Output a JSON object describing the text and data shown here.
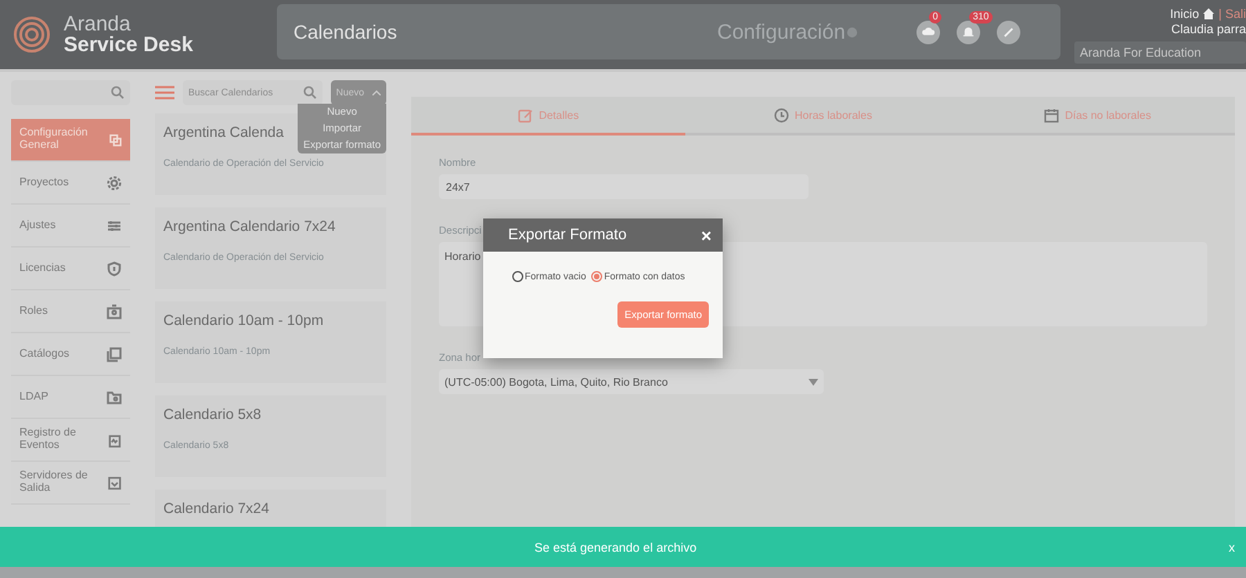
{
  "header": {
    "brand_top": "Aranda",
    "brand_bottom": "Service Desk",
    "page_title": "Calendarios",
    "section": "Configuración",
    "indicators": [
      {
        "kind": "cloud",
        "badge": "0"
      },
      {
        "kind": "bell",
        "badge": "310"
      },
      {
        "kind": "wand"
      }
    ],
    "home_link": "Inicio",
    "logout_link": "| Sali",
    "user": "Claudia parra",
    "tenant": "Aranda For Education"
  },
  "sidebar": {
    "items": [
      {
        "label": "Configuración General",
        "selected": true
      },
      {
        "label": "Proyectos",
        "selected": false
      },
      {
        "label": "Ajustes",
        "selected": false
      },
      {
        "label": "Licencias",
        "selected": false
      },
      {
        "label": "Roles",
        "selected": false
      },
      {
        "label": "Catálogos",
        "selected": false
      },
      {
        "label": "LDAP",
        "selected": false
      },
      {
        "label": "Registro de Eventos",
        "selected": false
      },
      {
        "label": "Servidores de Salida",
        "selected": false
      }
    ]
  },
  "list": {
    "search_placeholder": "Buscar Calendarios",
    "new_button": "Nuevo",
    "menu": [
      "Nuevo",
      "Importar",
      "Exportar formato"
    ],
    "cards": [
      {
        "title": "Argentina Calenda",
        "subtitle": "Calendario de Operación del Servicio"
      },
      {
        "title": "Argentina Calendario 7x24",
        "subtitle": "Calendario de Operación del Servicio"
      },
      {
        "title": "Calendario 10am - 10pm",
        "subtitle": "Calendario 10am - 10pm"
      },
      {
        "title": "Calendario 5x8",
        "subtitle": "Calendario 5x8"
      },
      {
        "title": "Calendario 7x24"
      }
    ]
  },
  "detail": {
    "tabs": [
      {
        "label": "Detalles",
        "selected": true
      },
      {
        "label": "Horas laborales",
        "selected": false
      },
      {
        "label": "Días no laborales",
        "selected": false
      }
    ],
    "name_label": "Nombre",
    "name_value": "24x7",
    "description_label": "Descripci",
    "description_value": "Horario",
    "timezone_label": "Zona hor",
    "timezone_value": "(UTC-05:00) Bogota, Lima, Quito, Rio Branco"
  },
  "dialog": {
    "title": "Exportar Formato",
    "close": "×",
    "options": [
      {
        "label": "Formato vacio",
        "selected": false
      },
      {
        "label": "Formato con datos",
        "selected": true
      }
    ],
    "button": "Exportar formato"
  },
  "toast": {
    "message": "Se está generando el archivo",
    "close": "x"
  }
}
